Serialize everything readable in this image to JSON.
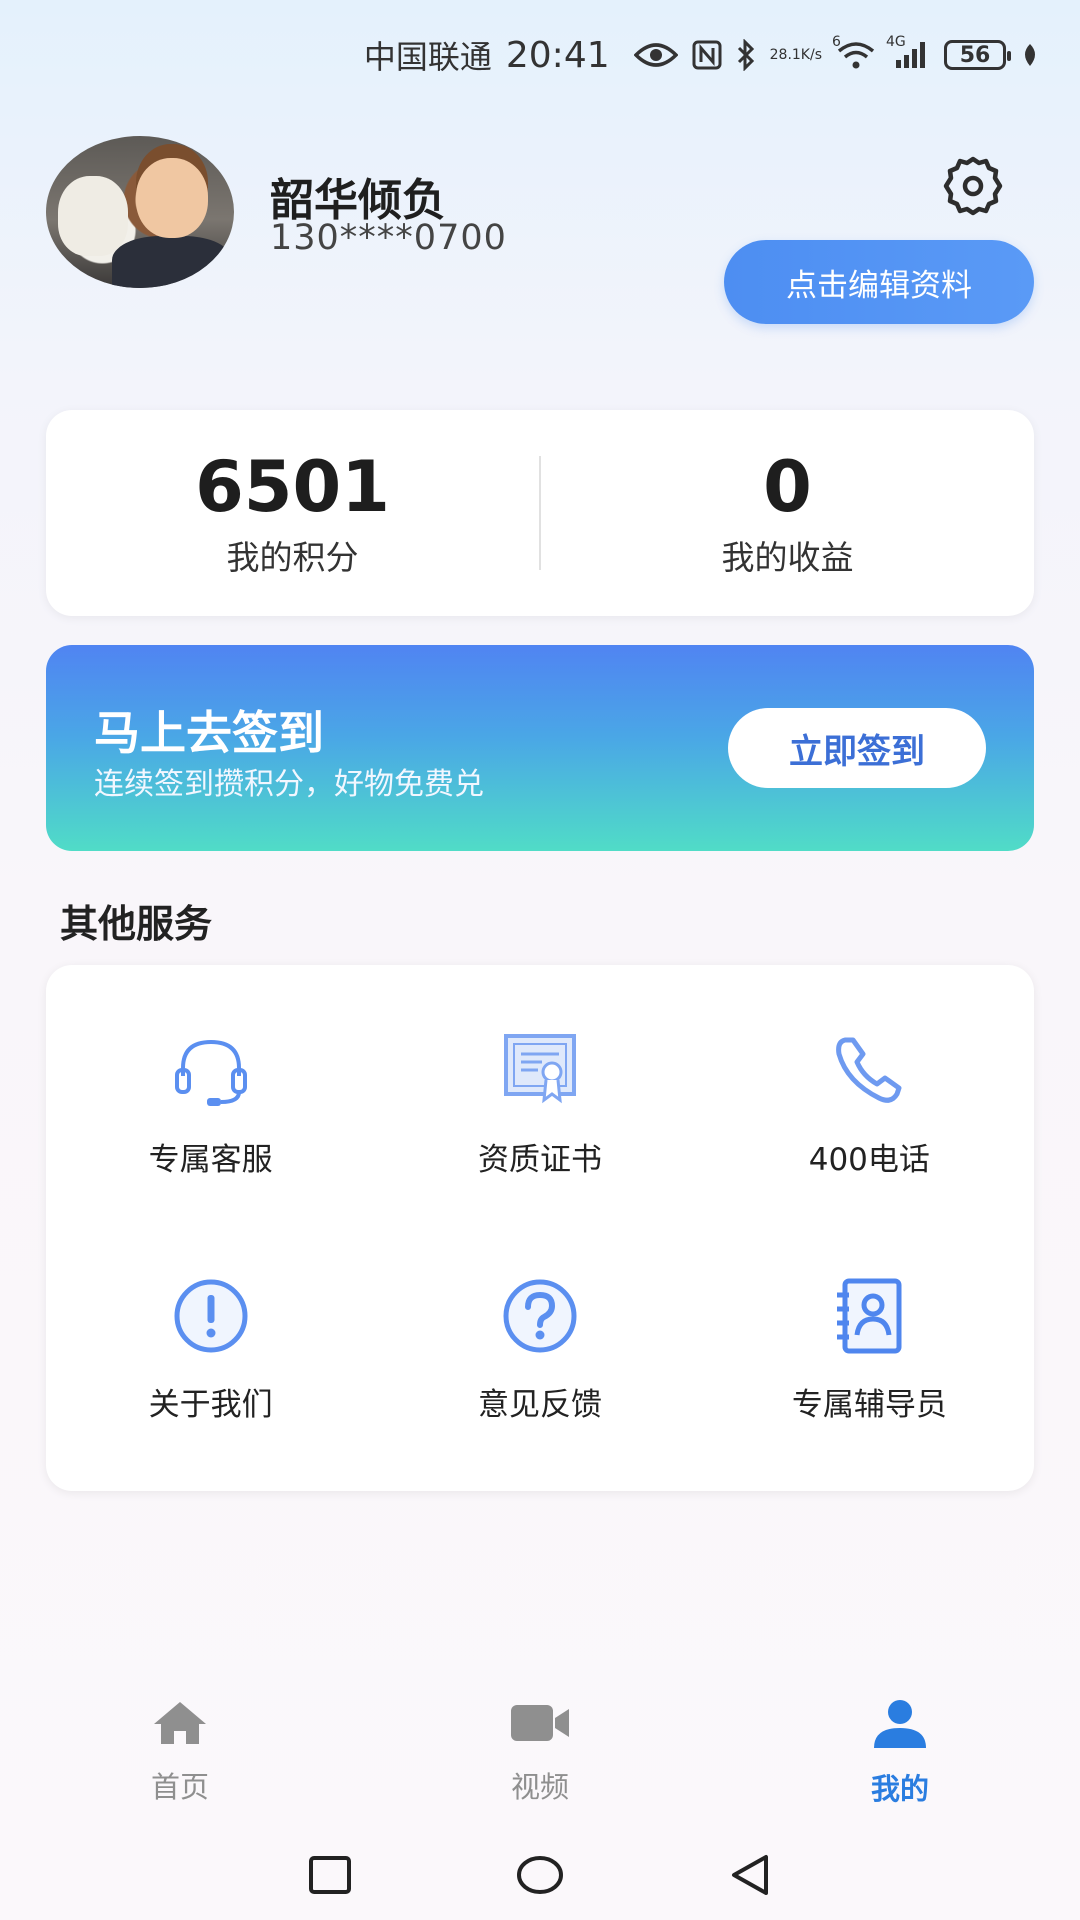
{
  "status_bar": {
    "carrier": "中国联通",
    "time": "20:41",
    "speed": "28.1",
    "speed_unit": "K/s",
    "wifi_badge": "6",
    "net_type": "4G",
    "battery": "56",
    "icons": [
      "eye-icon",
      "nfc-icon",
      "bluetooth-icon",
      "wifi-icon",
      "signal-icon",
      "battery-icon",
      "leaf-icon"
    ]
  },
  "profile": {
    "name": "韶华倾负",
    "phone": "130****0700",
    "edit_label": "点击编辑资料",
    "settings_icon": "gear-icon"
  },
  "stats": [
    {
      "value": "6501",
      "label": "我的积分"
    },
    {
      "value": "0",
      "label": "我的收益"
    }
  ],
  "signin": {
    "title": "马上去签到",
    "subtitle": "连续签到攒积分，好物免费兑",
    "button": "立即签到",
    "gradient_top": "#5084f2",
    "gradient_bottom": "#50dcc7"
  },
  "services": {
    "title": "其他服务",
    "items": [
      {
        "label": "专属客服",
        "icon": "headset-icon"
      },
      {
        "label": "资质证书",
        "icon": "certificate-icon"
      },
      {
        "label": "400电话",
        "icon": "phone-icon"
      },
      {
        "label": "关于我们",
        "icon": "info-icon"
      },
      {
        "label": "意见反馈",
        "icon": "help-icon"
      },
      {
        "label": "专属辅导员",
        "icon": "contact-book-icon"
      }
    ],
    "icon_color": "#5b8ff0"
  },
  "bottom_nav": {
    "items": [
      {
        "label": "首页",
        "icon": "home-icon",
        "active": false
      },
      {
        "label": "视频",
        "icon": "video-icon",
        "active": false
      },
      {
        "label": "我的",
        "icon": "user-icon",
        "active": true
      }
    ],
    "active_color": "#2a7de0",
    "inactive_color": "#8f8f8f"
  }
}
